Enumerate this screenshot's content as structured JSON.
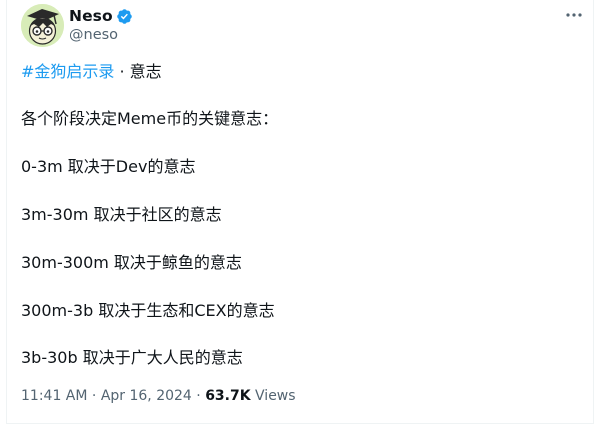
{
  "author": {
    "display_name": "Neso",
    "handle": "@neso",
    "verified": true
  },
  "tweet": {
    "hashtag": "#金狗启示录",
    "hashtag_suffix": " · 意志",
    "lines": [
      "各个阶段决定Meme币的关键意志：",
      "0-3m 取决于Dev的意志",
      "3m-30m 取决于社区的意志",
      "30m-300m 取决于鲸鱼的意志",
      "300m-3b 取决于生态和CEX的意志",
      "3b-30b 取决于广大人民的意志"
    ]
  },
  "meta": {
    "time": "11:41 AM",
    "separator": " · ",
    "date": "Apr 16, 2024",
    "views_count": "63.7K",
    "views_label": "Views"
  },
  "icons": {
    "verified": "verified-badge-icon",
    "more": "more-horizontal-icon"
  },
  "colors": {
    "accent": "#1d9bf0",
    "text": "#0f1419",
    "muted": "#536471"
  }
}
